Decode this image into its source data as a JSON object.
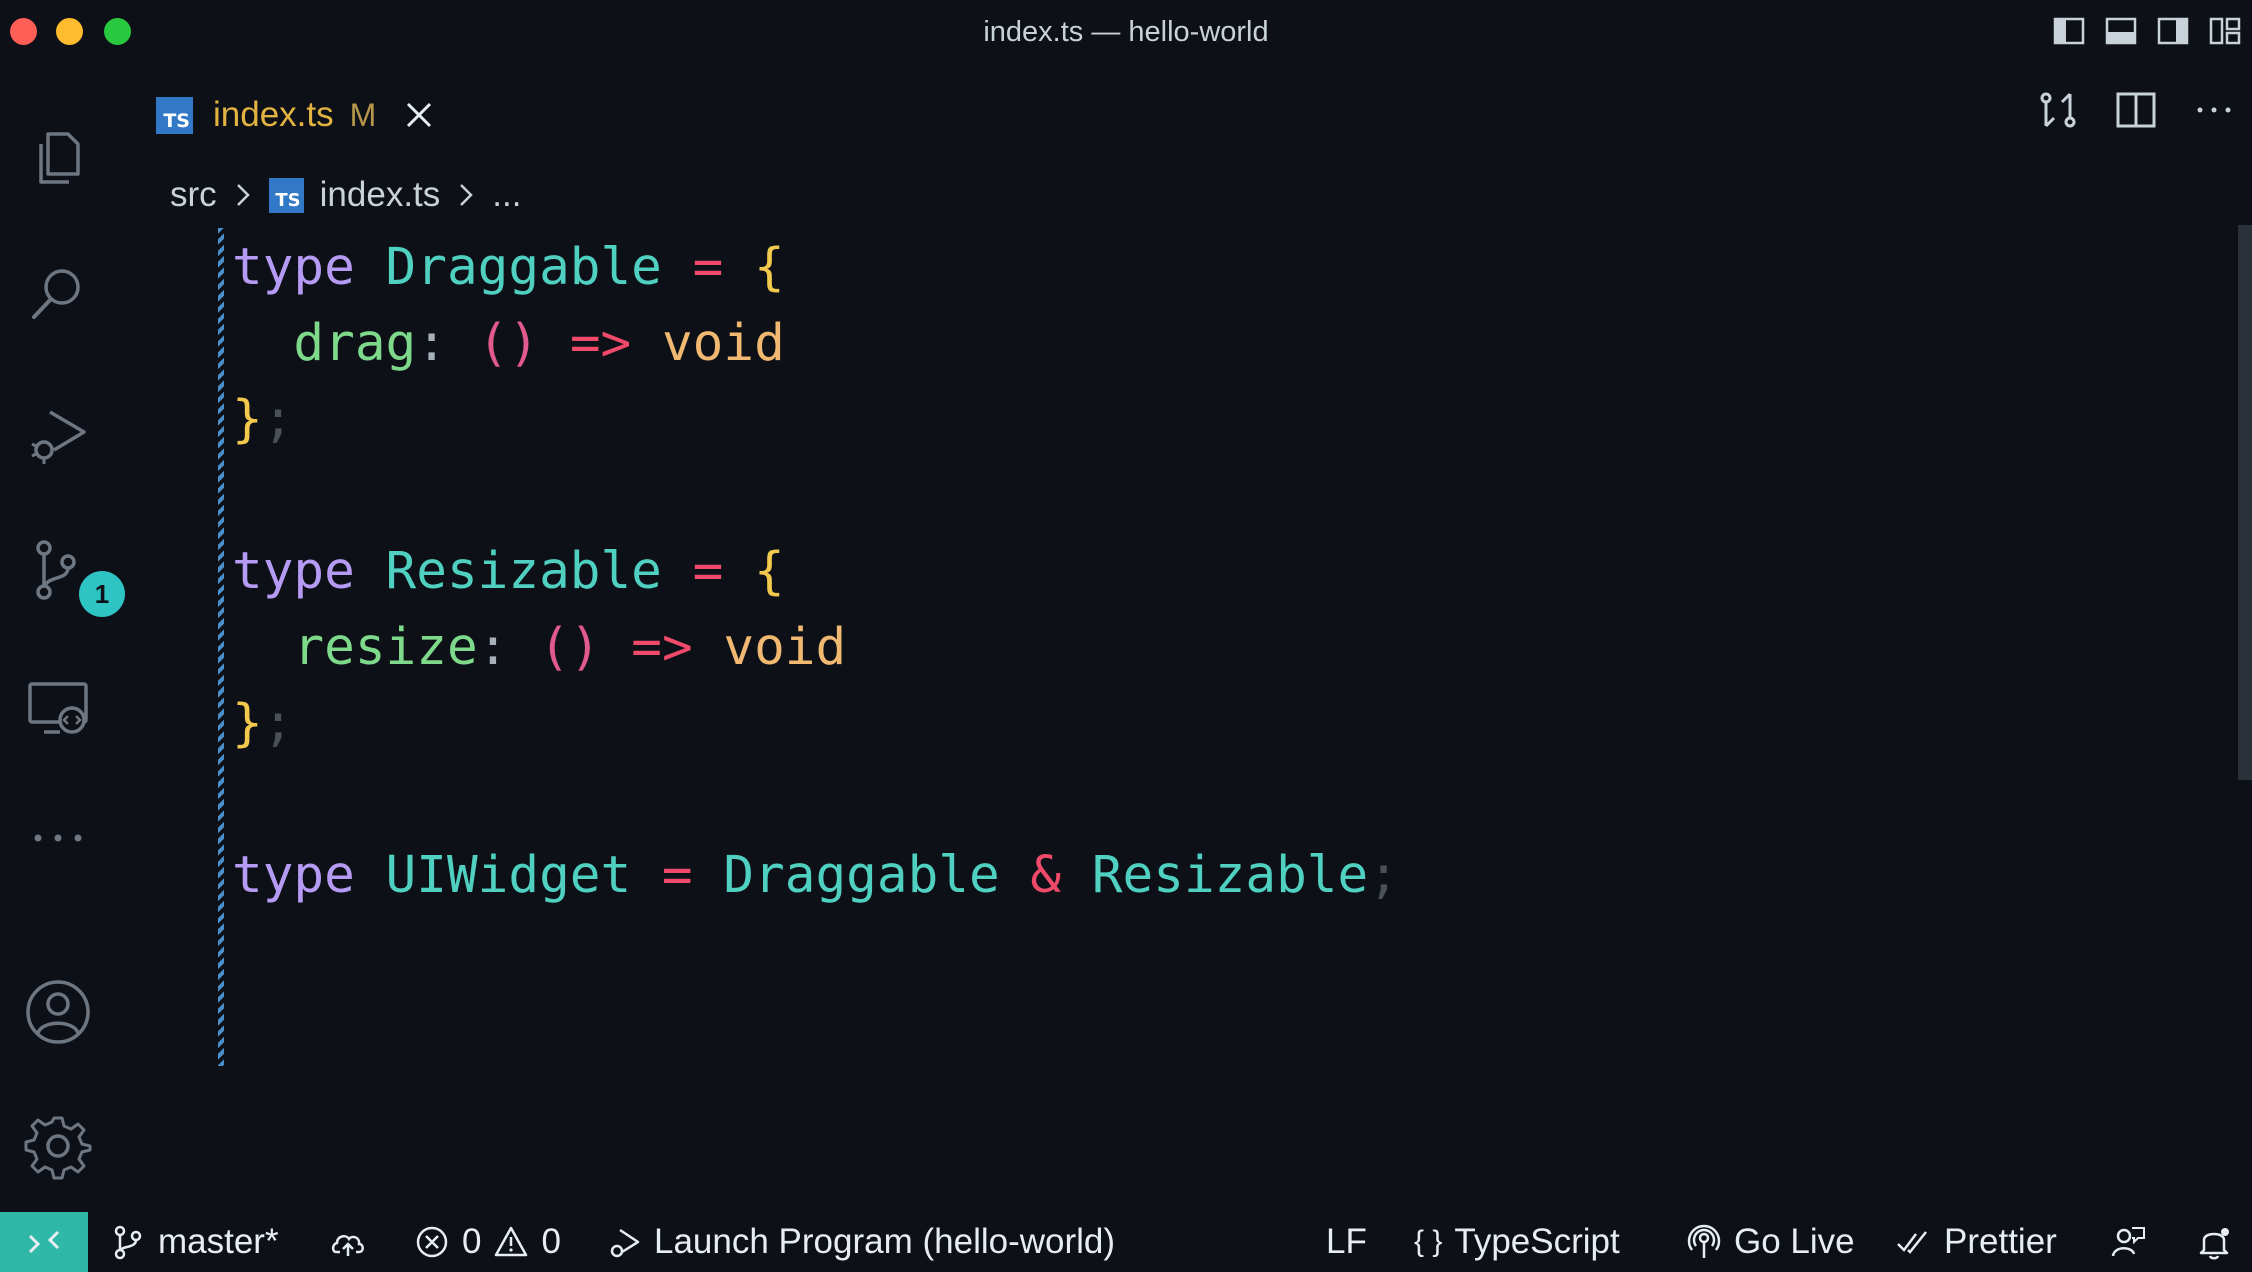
{
  "window": {
    "title": "index.ts — hello-world"
  },
  "activity_bar": {
    "source_control_badge": "1"
  },
  "tab": {
    "ts_icon": "TS",
    "filename": "index.ts",
    "modified": "M"
  },
  "breadcrumb": {
    "folder": "src",
    "file": "index.ts",
    "ellipsis": "..."
  },
  "code": {
    "lines": [
      [
        {
          "t": "type",
          "c": "kw"
        },
        {
          "t": " "
        },
        {
          "t": "Draggable",
          "c": "tn"
        },
        {
          "t": " "
        },
        {
          "t": "=",
          "c": "op"
        },
        {
          "t": " "
        },
        {
          "t": "{",
          "c": "brace"
        }
      ],
      [
        {
          "t": "  "
        },
        {
          "t": "drag",
          "c": "prop"
        },
        {
          "t": ":",
          "c": "punc"
        },
        {
          "t": " "
        },
        {
          "t": "()",
          "c": "par"
        },
        {
          "t": " "
        },
        {
          "t": "=>",
          "c": "op"
        },
        {
          "t": " "
        },
        {
          "t": "void",
          "c": "void"
        }
      ],
      [
        {
          "t": "}",
          "c": "brace"
        },
        {
          "t": ";",
          "c": "semi"
        }
      ],
      [],
      [
        {
          "t": "type",
          "c": "kw"
        },
        {
          "t": " "
        },
        {
          "t": "Resizable",
          "c": "tn"
        },
        {
          "t": " "
        },
        {
          "t": "=",
          "c": "op"
        },
        {
          "t": " "
        },
        {
          "t": "{",
          "c": "brace"
        }
      ],
      [
        {
          "t": "  "
        },
        {
          "t": "resize",
          "c": "prop"
        },
        {
          "t": ":",
          "c": "punc"
        },
        {
          "t": " "
        },
        {
          "t": "()",
          "c": "par"
        },
        {
          "t": " "
        },
        {
          "t": "=>",
          "c": "op"
        },
        {
          "t": " "
        },
        {
          "t": "void",
          "c": "void"
        }
      ],
      [
        {
          "t": "}",
          "c": "brace"
        },
        {
          "t": ";",
          "c": "semi"
        }
      ],
      [],
      [
        {
          "t": "type",
          "c": "kw"
        },
        {
          "t": " "
        },
        {
          "t": "UIWidget",
          "c": "tn"
        },
        {
          "t": " "
        },
        {
          "t": "=",
          "c": "op"
        },
        {
          "t": " "
        },
        {
          "t": "Draggable",
          "c": "tn"
        },
        {
          "t": " "
        },
        {
          "t": "&",
          "c": "op"
        },
        {
          "t": " "
        },
        {
          "t": "Resizable",
          "c": "tn"
        },
        {
          "t": ";",
          "c": "semi"
        }
      ]
    ]
  },
  "status_bar": {
    "branch": "master*",
    "errors": "0",
    "warnings": "0",
    "launch": "Launch Program (hello-world)",
    "eol": "LF",
    "language_braces": "{ }",
    "language": "TypeScript",
    "go_live": "Go Live",
    "prettier": "Prettier"
  }
}
